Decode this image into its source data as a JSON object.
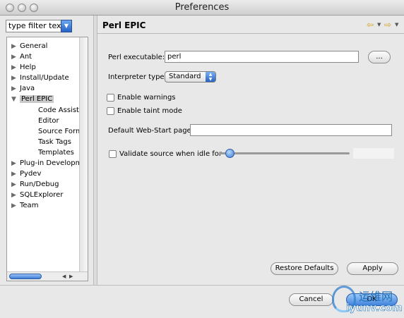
{
  "window": {
    "title": "Preferences"
  },
  "filter": {
    "placeholder": "type filter text"
  },
  "tree": {
    "items": [
      {
        "label": "General",
        "expanded": false
      },
      {
        "label": "Ant",
        "expanded": false
      },
      {
        "label": "Help",
        "expanded": false
      },
      {
        "label": "Install/Update",
        "expanded": false
      },
      {
        "label": "Java",
        "expanded": false
      },
      {
        "label": "Perl EPIC",
        "expanded": true,
        "selected": true
      },
      {
        "label": "Code Assist",
        "child": true
      },
      {
        "label": "Editor",
        "child": true
      },
      {
        "label": "Source Form",
        "child": true
      },
      {
        "label": "Task Tags",
        "child": true
      },
      {
        "label": "Templates",
        "child": true
      },
      {
        "label": "Plug-in Developm",
        "expanded": false
      },
      {
        "label": "Pydev",
        "expanded": false
      },
      {
        "label": "Run/Debug",
        "expanded": false
      },
      {
        "label": "SQLExplorer",
        "expanded": false
      },
      {
        "label": "Team",
        "expanded": false
      }
    ]
  },
  "page": {
    "title": "Perl EPIC",
    "perl_executable_label": "Perl executable:",
    "perl_executable_value": "perl",
    "browse_label": "...",
    "interpreter_label": "Interpreter type:",
    "interpreter_value": "Standard",
    "enable_warnings_label": "Enable warnings",
    "enable_warnings_checked": false,
    "enable_taint_label": "Enable taint mode",
    "enable_taint_checked": false,
    "webstart_label": "Default Web-Start page:",
    "webstart_value": "",
    "validate_label": "Validate source when idle for",
    "validate_checked": false,
    "validate_slider_fraction": 0.05,
    "validate_value": "",
    "restore_defaults_label": "Restore Defaults",
    "apply_label": "Apply"
  },
  "dialog": {
    "cancel_label": "Cancel",
    "ok_label": "OK"
  },
  "watermark": {
    "cn_text": "运维网",
    "url_text": "iyunv.com"
  },
  "colors": {
    "accent_blue": "#2563c7",
    "nav_arrow": "#d6a21e",
    "selection": "#c9c9c9"
  }
}
